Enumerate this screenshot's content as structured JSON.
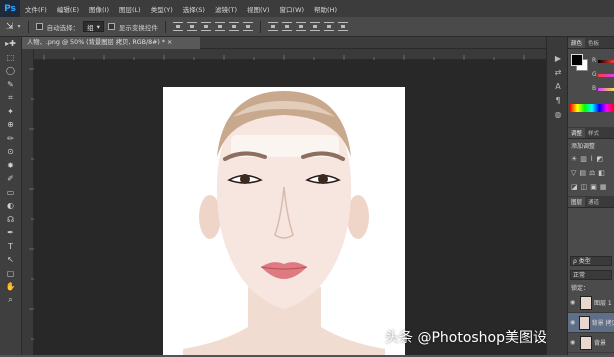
{
  "app": {
    "logo": "Ps"
  },
  "menu": [
    "文件(F)",
    "编辑(E)",
    "图像(I)",
    "图层(L)",
    "类型(Y)",
    "选择(S)",
    "滤镜(T)",
    "视图(V)",
    "窗口(W)",
    "帮助(H)"
  ],
  "options": {
    "auto_select_label": "自动选择：",
    "auto_select_value": "组",
    "show_transform_label": "显示变换控件"
  },
  "document": {
    "tab_title": "人物、.png @ 50% (背景图层 拷贝, RGB/8#) *",
    "close": "×"
  },
  "tools": [
    "▸✚",
    "⬚",
    "◯",
    "✎",
    "⌗",
    "✦",
    "⊕",
    "✏",
    "⊙",
    "✸",
    "✐",
    "▭",
    "◐",
    "☊",
    "✒",
    "T",
    "↖",
    "▢",
    "✋",
    "⌕"
  ],
  "dock_icons": [
    "▶",
    "⇄",
    "A",
    "¶",
    "◍"
  ],
  "panels": {
    "color_tabs": [
      "颜色",
      "色板"
    ],
    "color_slider_labels": [
      "R",
      "G",
      "B"
    ],
    "colors": {
      "r": "#ff3b3b",
      "g": "#d83cff",
      "b": "#f0e63a"
    },
    "adjust_tabs": [
      "调整",
      "样式"
    ],
    "adjust_title": "添加调整",
    "layers_tabs": [
      "图层",
      "通道"
    ],
    "layers_filter": "ρ 类型",
    "layers_mode": "正常",
    "layers_lock": "锁定：",
    "layers": [
      {
        "name": "图层 1"
      },
      {
        "name": "背景 拷贝"
      },
      {
        "name": "背景"
      }
    ]
  },
  "watermark": "头条 @Photoshop美图设计师"
}
